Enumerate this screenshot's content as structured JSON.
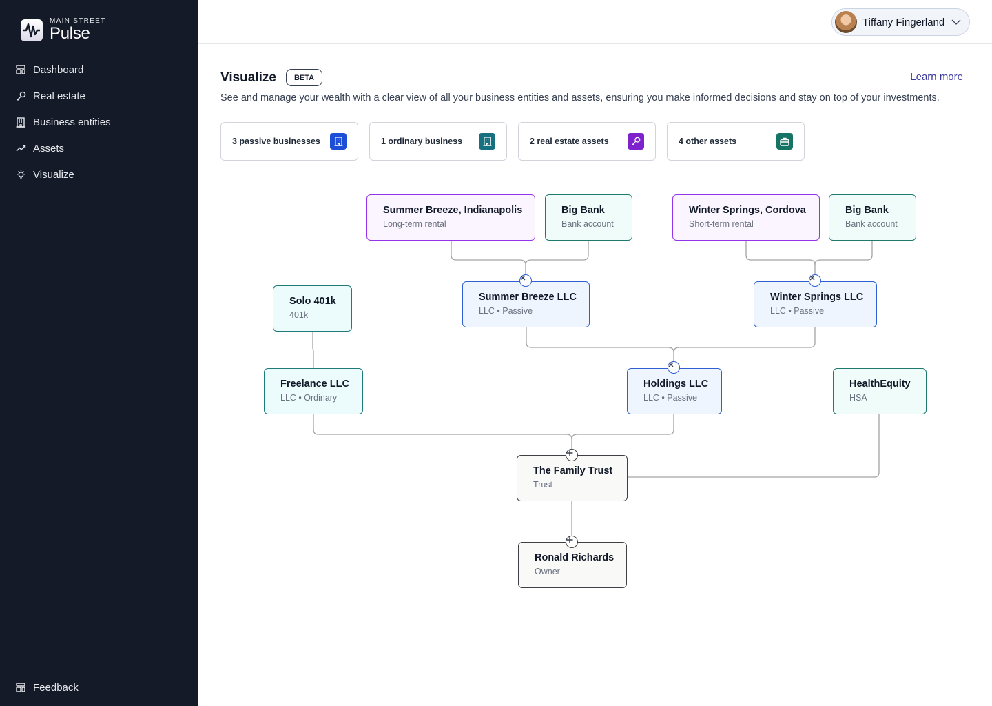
{
  "brand": {
    "small": "MAIN STREET",
    "big": "Pulse"
  },
  "sidebar": {
    "items": [
      {
        "label": "Dashboard",
        "icon": "dashboard-icon"
      },
      {
        "label": "Real estate",
        "icon": "key-icon"
      },
      {
        "label": "Business entities",
        "icon": "building-icon"
      },
      {
        "label": "Assets",
        "icon": "trending-up-icon"
      },
      {
        "label": "Visualize",
        "icon": "lightbulb-icon"
      }
    ],
    "bottom": {
      "label": "Feedback",
      "icon": "feedback-icon"
    }
  },
  "user": {
    "name": "Tiffany Fingerland"
  },
  "page": {
    "title": "Visualize",
    "badge": "BETA",
    "learn_more": "Learn more",
    "description": "See and manage your wealth with a clear view of all your business entities and assets, ensuring you make informed decisions and stay on top of your investments."
  },
  "stats": [
    {
      "label": "3 passive businesses",
      "icon": "building-icon",
      "color": "#1d4ed8"
    },
    {
      "label": "1 ordinary business",
      "icon": "building-icon",
      "color": "#16707f"
    },
    {
      "label": "2 real estate assets",
      "icon": "key-icon",
      "color": "#7e22ce"
    },
    {
      "label": "4 other assets",
      "icon": "briefcase-icon",
      "color": "#167464"
    }
  ],
  "nodes": {
    "summer_breeze_prop": {
      "title": "Summer Breeze, Indianapolis",
      "sub": "Long-term rental"
    },
    "big_bank_1": {
      "title": "Big Bank",
      "sub": "Bank account"
    },
    "winter_springs_prop": {
      "title": "Winter Springs, Cordova",
      "sub": "Short-term rental"
    },
    "big_bank_2": {
      "title": "Big Bank",
      "sub": "Bank account"
    },
    "summer_breeze_llc": {
      "title": "Summer Breeze LLC",
      "sub": "LLC • Passive"
    },
    "winter_springs_llc": {
      "title": "Winter Springs LLC",
      "sub": "LLC • Passive"
    },
    "solo_401k": {
      "title": "Solo 401k",
      "sub": "401k"
    },
    "freelance_llc": {
      "title": "Freelance LLC",
      "sub": "LLC • Ordinary"
    },
    "holdings_llc": {
      "title": "Holdings LLC",
      "sub": "LLC • Passive"
    },
    "health_equity": {
      "title": "HealthEquity",
      "sub": "HSA"
    },
    "family_trust": {
      "title": "The Family Trust",
      "sub": "Trust"
    },
    "ronald": {
      "title": "Ronald Richards",
      "sub": "Owner"
    }
  }
}
